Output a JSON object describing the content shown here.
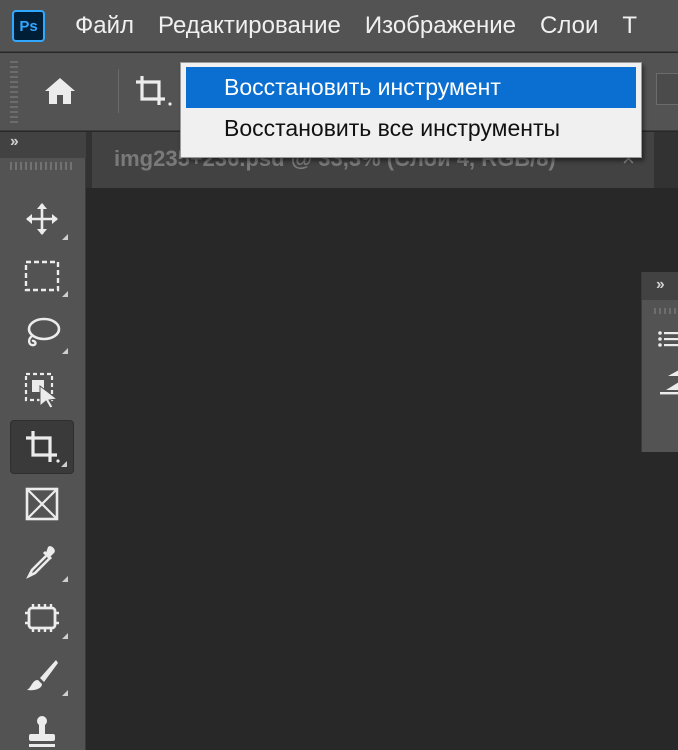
{
  "app": {
    "logo_text": "Ps",
    "brand_color": "#31a8ff"
  },
  "menubar": {
    "items": [
      "Файл",
      "Редактирование",
      "Изображение",
      "Слои",
      "Т"
    ]
  },
  "optionsbar": {
    "home_icon": "home-icon",
    "current_tool_icon": "crop-icon"
  },
  "context_menu": {
    "items": [
      {
        "label": "Восстановить инструмент",
        "selected": true
      },
      {
        "label": "Восстановить все инструменты",
        "selected": false
      }
    ],
    "selected_color": "#0a6fd0"
  },
  "document": {
    "tab_label": "img235+236.psd @ 33,3% (Слой 4, RGB/8)",
    "close_glyph": "×"
  },
  "toolbar": {
    "collapse_glyph": "››",
    "tools": [
      {
        "name": "move-tool",
        "icon": "move-icon"
      },
      {
        "name": "marquee-tool",
        "icon": "rect-marquee-icon"
      },
      {
        "name": "lasso-tool",
        "icon": "lasso-icon"
      },
      {
        "name": "object-selection-tool",
        "icon": "object-selection-icon"
      },
      {
        "name": "crop-tool",
        "icon": "crop-icon",
        "active": true
      },
      {
        "name": "frame-tool",
        "icon": "frame-icon"
      },
      {
        "name": "eyedropper-tool",
        "icon": "eyedropper-icon"
      },
      {
        "name": "spot-healing-tool",
        "icon": "bandage-icon"
      },
      {
        "name": "brush-tool",
        "icon": "brush-icon"
      },
      {
        "name": "clone-stamp-tool",
        "icon": "stamp-icon"
      }
    ]
  },
  "right_panel": {
    "collapse_glyph": "››",
    "icons": [
      "list-icon",
      "adjust-icon"
    ]
  }
}
